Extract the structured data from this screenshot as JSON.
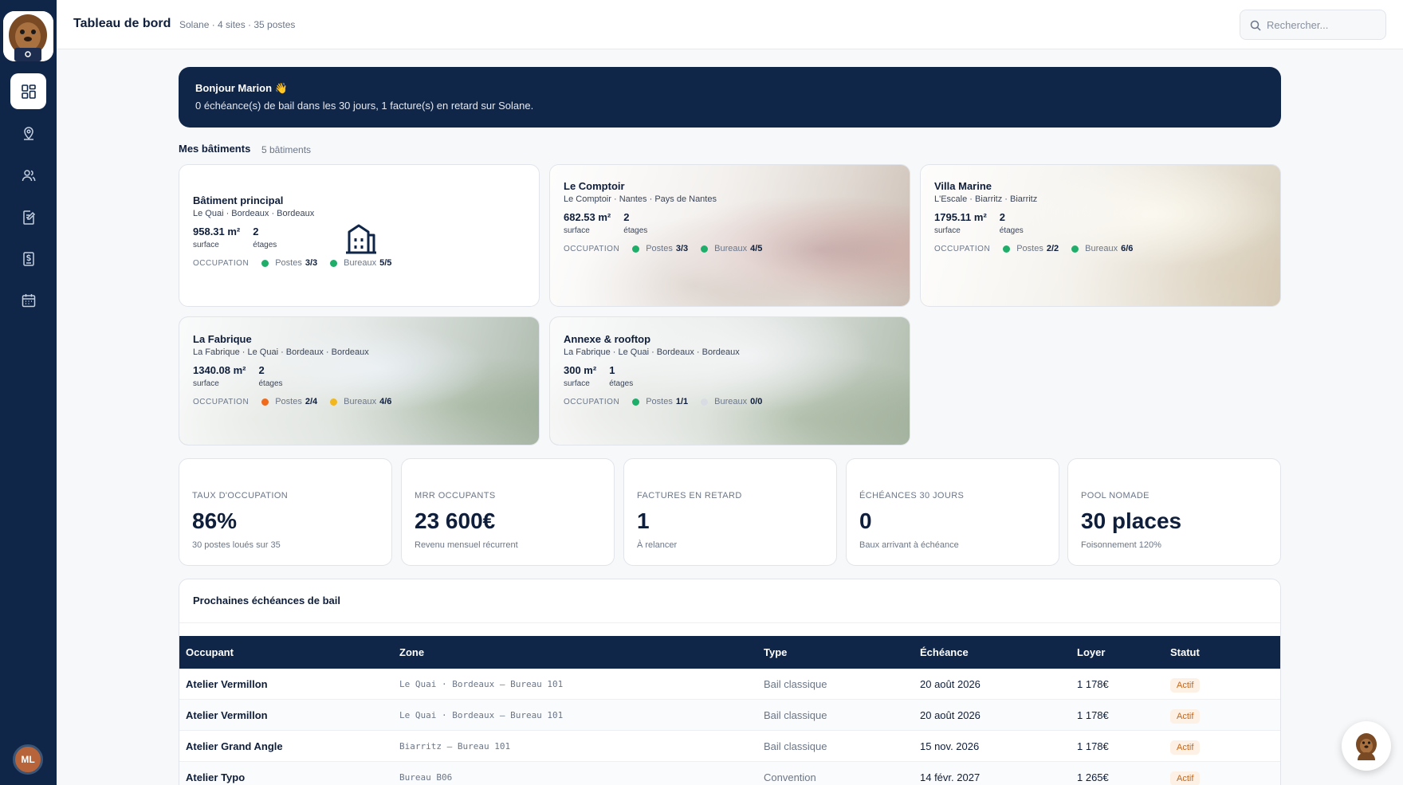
{
  "app": {
    "title": "Tableau de bord",
    "subtitle": "Solane · 4 sites · 35 postes"
  },
  "search": {
    "placeholder": "Rechercher..."
  },
  "user": {
    "initials": "ML"
  },
  "nav": {
    "items": [
      "dashboard-icon",
      "map-pin-icon",
      "users-icon",
      "edit-doc-icon",
      "billing-icon",
      "calendar-icon"
    ]
  },
  "banner": {
    "title": "Bonjour Marion 👋",
    "text": "0 échéance(s) de bail dans les 30 jours, 1 facture(s) en retard sur Solane."
  },
  "buildings_section": {
    "title": "Mes bâtiments",
    "count": "5 bâtiments"
  },
  "buildings": [
    {
      "name": "Bâtiment principal",
      "location": "Le Quai · Bordeaux · Bordeaux",
      "surface": "958.31 m²",
      "surface_label": "surface",
      "floors": "2",
      "floors_label": "étages",
      "occupancy_label": "OCCUPATION",
      "postes_label": "Postes",
      "postes": "3/3",
      "bureaux_label": "Bureaux",
      "bureaux": "5/5",
      "postes_color": "#1fae6a",
      "bureaux_color": "#1fae6a"
    },
    {
      "name": "Le Comptoir",
      "location": "Le Comptoir · Nantes · Pays de Nantes",
      "surface": "682.53 m²",
      "surface_label": "surface",
      "floors": "2",
      "floors_label": "étages",
      "occupancy_label": "OCCUPATION",
      "postes_label": "Postes",
      "postes": "3/3",
      "bureaux_label": "Bureaux",
      "bureaux": "4/5",
      "postes_color": "#1fae6a",
      "bureaux_color": "#1fae6a"
    },
    {
      "name": "Villa Marine",
      "location": "L'Escale · Biarritz · Biarritz",
      "surface": "1795.11 m²",
      "surface_label": "surface",
      "floors": "2",
      "floors_label": "étages",
      "occupancy_label": "OCCUPATION",
      "postes_label": "Postes",
      "postes": "2/2",
      "bureaux_label": "Bureaux",
      "bureaux": "6/6",
      "postes_color": "#1fae6a",
      "bureaux_color": "#1fae6a"
    },
    {
      "name": "La Fabrique",
      "location": "La Fabrique · Le Quai · Bordeaux · Bordeaux",
      "surface": "1340.08 m²",
      "surface_label": "surface",
      "floors": "2",
      "floors_label": "étages",
      "occupancy_label": "OCCUPATION",
      "postes_label": "Postes",
      "postes": "2/4",
      "bureaux_label": "Bureaux",
      "bureaux": "4/6",
      "postes_color": "#f06a1a",
      "bureaux_color": "#f2b71d"
    },
    {
      "name": "Annexe & rooftop",
      "location": "La Fabrique · Le Quai · Bordeaux · Bordeaux",
      "surface": "300 m²",
      "surface_label": "surface",
      "floors": "1",
      "floors_label": "étages",
      "occupancy_label": "OCCUPATION",
      "postes_label": "Postes",
      "postes": "1/1",
      "bureaux_label": "Bureaux",
      "bureaux": "0/0",
      "postes_color": "#1fae6a",
      "bureaux_color": "#d9dde3"
    }
  ],
  "kpis": [
    {
      "label": "TAUX D'OCCUPATION",
      "value": "86%",
      "sub": "30 postes loués sur 35"
    },
    {
      "label": "MRR OCCUPANTS",
      "value": "23 600€",
      "sub": "Revenu mensuel récurrent"
    },
    {
      "label": "FACTURES EN RETARD",
      "value": "1",
      "sub": "À relancer"
    },
    {
      "label": "ÉCHÉANCES 30 JOURS",
      "value": "0",
      "sub": "Baux arrivant à échéance"
    },
    {
      "label": "POOL NOMADE",
      "value": "30 places",
      "sub": "Foisonnement 120%"
    }
  ],
  "leases": {
    "title": "Prochaines échéances de bail",
    "columns": [
      "Occupant",
      "Zone",
      "Type",
      "Échéance",
      "Loyer",
      "Statut"
    ],
    "rows": [
      {
        "occupant": "Atelier Vermillon",
        "zone": "Le Quai · Bordeaux — Bureau 101",
        "type": "Bail classique",
        "date": "20 août 2026",
        "rent": "1 178€",
        "status": "Actif"
      },
      {
        "occupant": "Atelier Vermillon",
        "zone": "Le Quai · Bordeaux — Bureau 101",
        "type": "Bail classique",
        "date": "20 août 2026",
        "rent": "1 178€",
        "status": "Actif"
      },
      {
        "occupant": "Atelier Grand Angle",
        "zone": "Biarritz — Bureau 101",
        "type": "Bail classique",
        "date": "15 nov. 2026",
        "rent": "1 178€",
        "status": "Actif"
      },
      {
        "occupant": "Atelier Typo",
        "zone": "Bureau B06",
        "type": "Convention",
        "date": "14 févr. 2027",
        "rent": "1 265€",
        "status": "Actif"
      }
    ]
  },
  "colors": {
    "navy": "#0f2649",
    "accent_green": "#1fae6a",
    "status_badge": "#c2671f"
  }
}
